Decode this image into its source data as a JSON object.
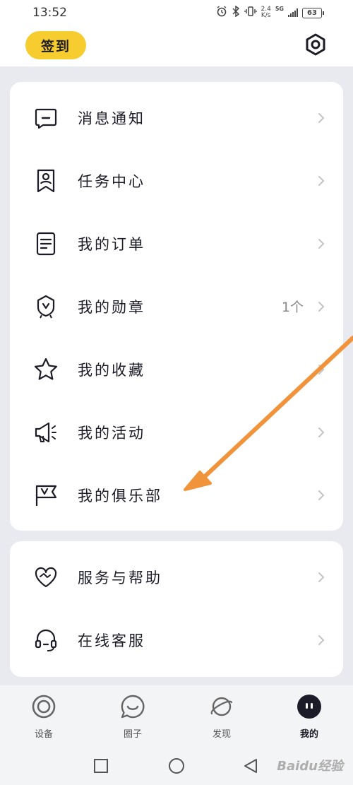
{
  "status_bar": {
    "time": "13:52",
    "net_speed_value": "2.4",
    "net_speed_unit": "K/s",
    "network": "5G",
    "battery": "63"
  },
  "header": {
    "checkin_label": "签到",
    "settings_icon": "hexagon-gear-icon"
  },
  "menu_card_1": [
    {
      "label": "消息通知",
      "icon": "message-icon"
    },
    {
      "label": "任务中心",
      "icon": "task-badge-icon"
    },
    {
      "label": "我的订单",
      "icon": "order-list-icon"
    },
    {
      "label": "我的勋章",
      "icon": "medal-icon",
      "count": "1个"
    },
    {
      "label": "我的收藏",
      "icon": "star-icon"
    },
    {
      "label": "我的活动",
      "icon": "megaphone-icon"
    },
    {
      "label": "我的俱乐部",
      "icon": "flag-icon"
    }
  ],
  "menu_card_2": [
    {
      "label": "服务与帮助",
      "icon": "heart-handshake-icon"
    },
    {
      "label": "在线客服",
      "icon": "headset-icon"
    }
  ],
  "bottom_nav": [
    {
      "label": "设备",
      "icon": "device-ring-icon",
      "active": false
    },
    {
      "label": "圈子",
      "icon": "smile-bubble-icon",
      "active": false
    },
    {
      "label": "发现",
      "icon": "planet-icon",
      "active": false
    },
    {
      "label": "我的",
      "icon": "profile-face-icon",
      "active": true
    }
  ],
  "watermark": "Baidu经验",
  "colors": {
    "accent_yellow": "#f6cc2e",
    "annotation_arrow": "#f0933a",
    "page_bg": "#e9eaef",
    "text_primary": "#1c1c28"
  }
}
